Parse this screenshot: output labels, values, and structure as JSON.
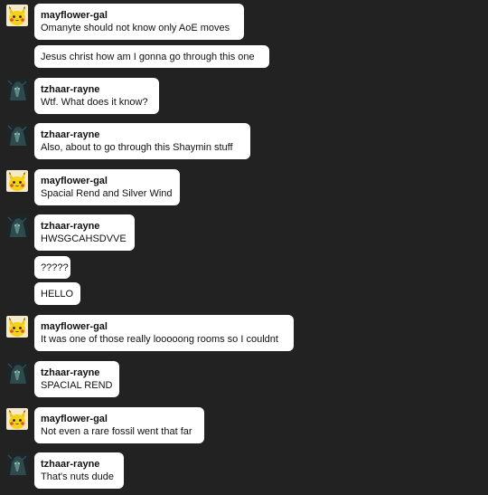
{
  "messages": [
    {
      "type": "header",
      "sender": "mayflower-gal",
      "avatar": "pikachu-avatar",
      "text": "Omanyte should not know only AoE moves"
    },
    {
      "type": "solo",
      "text": "Jesus christ how am I gonna go through this one"
    },
    {
      "type": "header",
      "sender": "tzhaar-rayne",
      "avatar": "dark-avatar",
      "text": "Wtf. What does it know?"
    },
    {
      "type": "header",
      "sender": "tzhaar-rayne",
      "avatar": "dark-avatar",
      "text": "Also, about to go through this Shaymin stuff"
    },
    {
      "type": "header",
      "sender": "mayflower-gal",
      "avatar": "pikachu-avatar",
      "text": "Spacial Rend and Silver Wind"
    },
    {
      "type": "header",
      "sender": "tzhaar-rayne",
      "avatar": "dark-avatar",
      "text": "HWSGCAHSDVVE"
    },
    {
      "type": "solo",
      "text": "?????"
    },
    {
      "type": "solo",
      "text": "HELLO"
    },
    {
      "type": "header",
      "sender": "mayflower-gal",
      "avatar": "pikachu-avatar",
      "text": "It was one of those really looooong rooms so I couldnt"
    },
    {
      "type": "header",
      "sender": "tzhaar-rayne",
      "avatar": "dark-avatar",
      "text": "SPACIAL REND"
    },
    {
      "type": "header",
      "sender": "mayflower-gal",
      "avatar": "pikachu-avatar",
      "text": "Not even a rare fossil went that far"
    },
    {
      "type": "header",
      "sender": "tzhaar-rayne",
      "avatar": "dark-avatar",
      "text": "That's nuts dude"
    }
  ],
  "colors": {
    "background": "#222222",
    "bubble": "#ffffff",
    "text": "#111111"
  }
}
